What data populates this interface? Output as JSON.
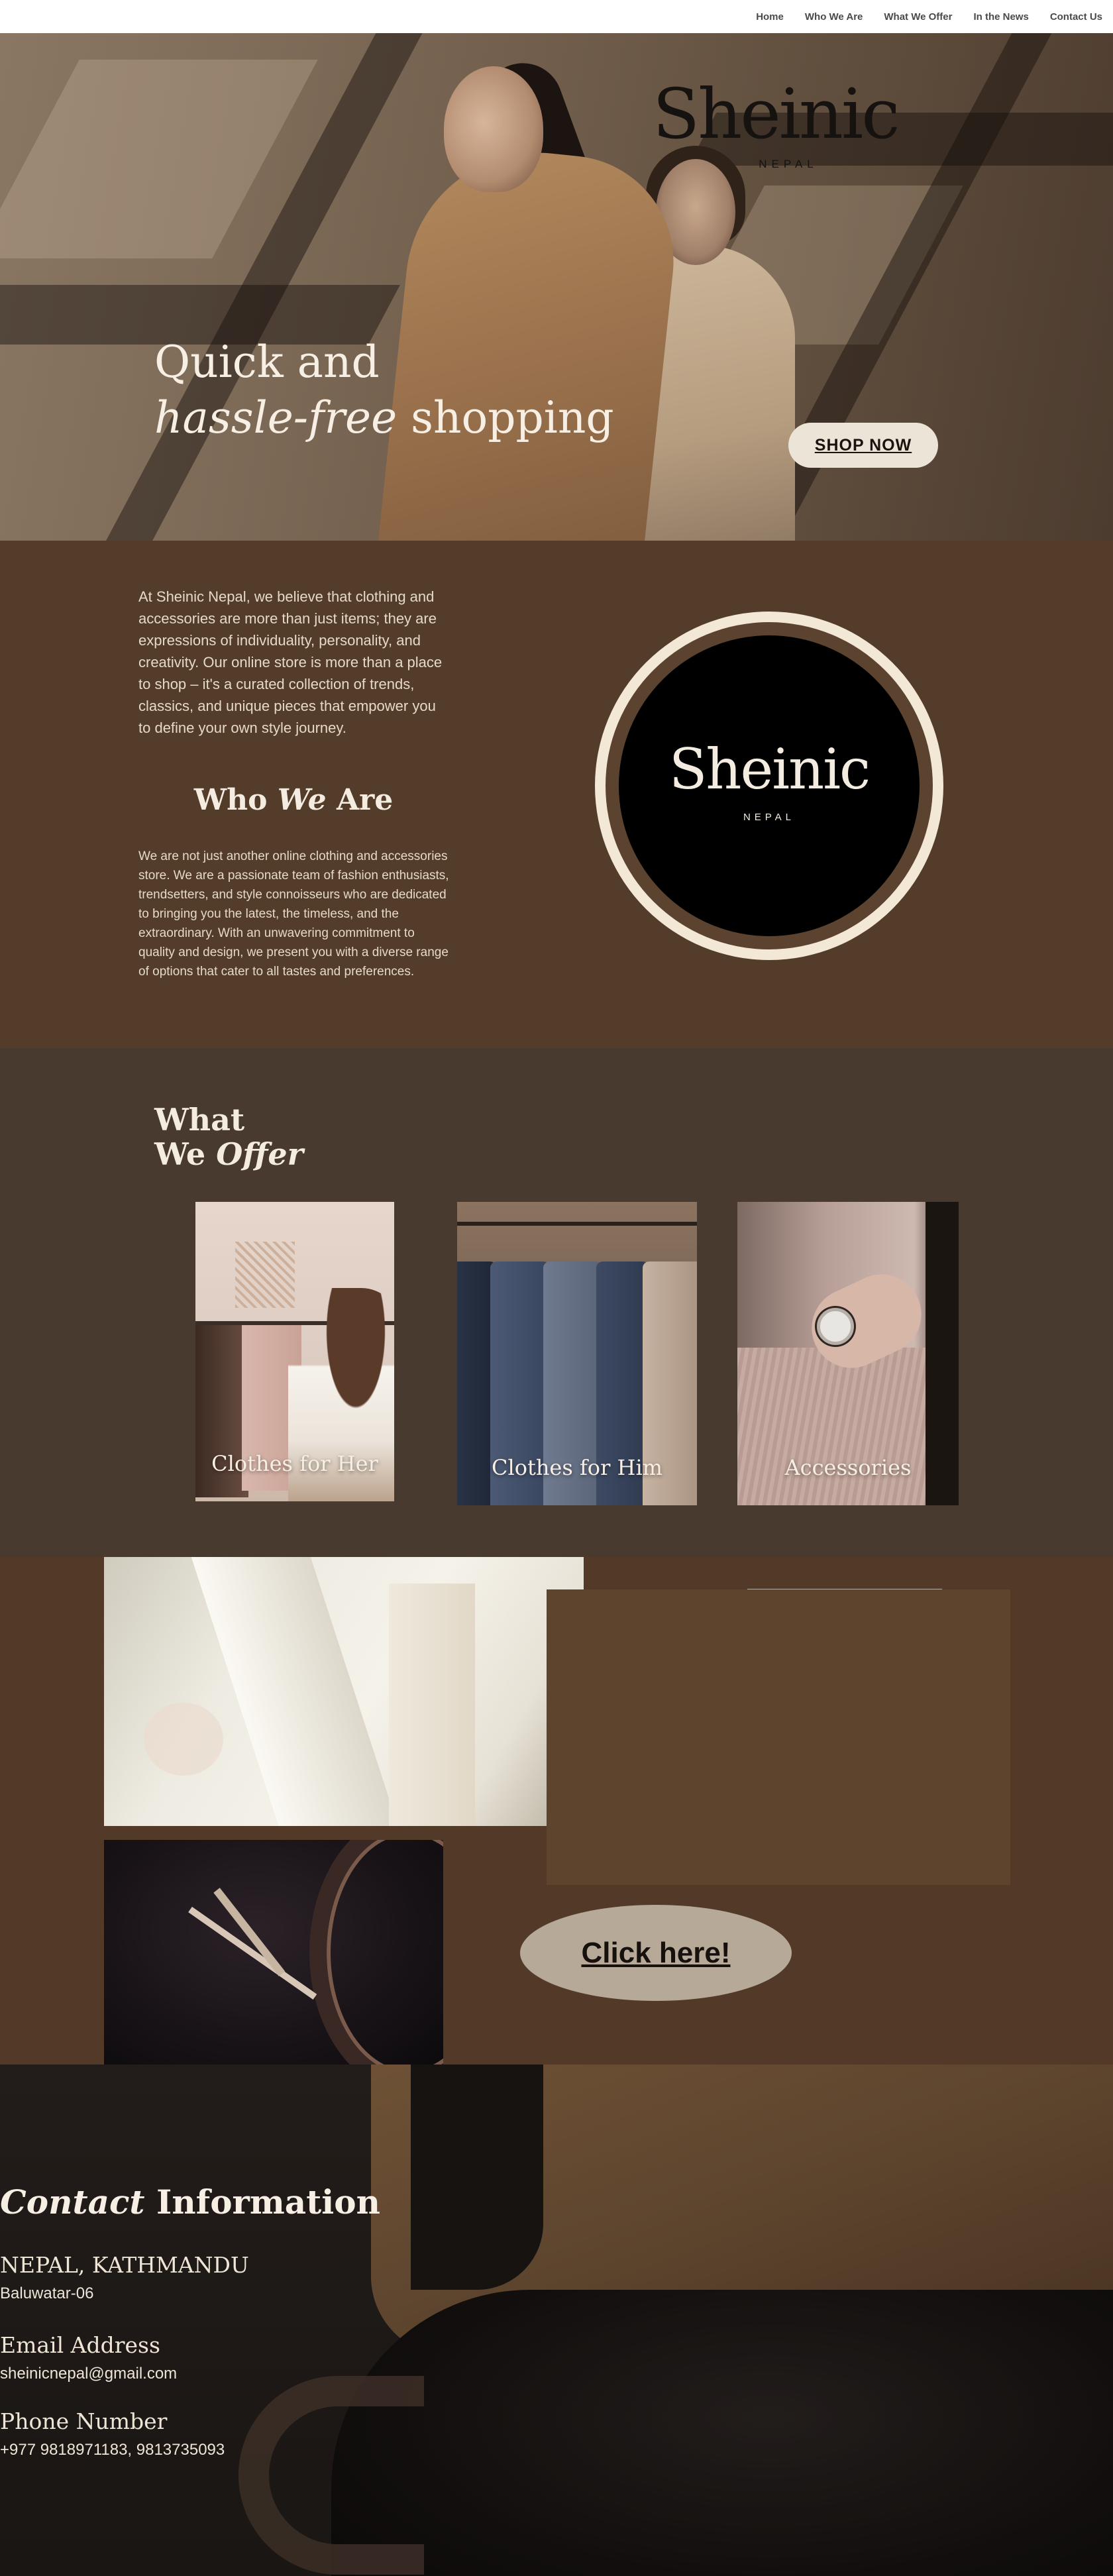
{
  "nav": {
    "links": [
      "Home",
      "Who We Are",
      "What We Offer",
      "In the News",
      "Contact Us"
    ]
  },
  "hero": {
    "logo_name": "Sheinic",
    "logo_sub": "NEPAL",
    "title_line1": "Quick and",
    "title_line2_italic": "hassle-free",
    "title_line2_rest": " shopping",
    "shop_button": "SHOP NOW"
  },
  "about": {
    "intro": "At Sheinic Nepal, we believe that clothing and accessories are more than just items; they are expressions of individuality, personality, and creativity. Our online store is more than a place to shop – it's a curated collection of trends, classics, and unique pieces that empower you to define your own style journey.",
    "heading_pre": "Who ",
    "heading_italic": "We",
    "heading_post": " Are",
    "body": "We are not just another online clothing and accessories store. We are a passionate team of fashion enthusiasts, trendsetters, and style connoisseurs who are dedicated to bringing you the latest, the timeless, and the extraordinary. With an unwavering commitment to quality and design, we present you with a diverse range of options that cater to all tastes and preferences.",
    "logo_name": "Sheinic",
    "logo_sub": "NEPAL"
  },
  "offer": {
    "heading_line1": "What",
    "heading_line2_pre": "We ",
    "heading_line2_italic": "Offer",
    "cards": [
      {
        "label": "Clothes for Her"
      },
      {
        "label": "Clothes for Him"
      },
      {
        "label": "Accessories"
      }
    ]
  },
  "gallery": {
    "button": "Click here!"
  },
  "contact": {
    "title_italic": "Contact",
    "title_rest": " Information",
    "location_label": "NEPAL, KATHMANDU",
    "location_value": "Baluwatar-06",
    "email_label": "Email Address",
    "email_value": "sheinicnepal@gmail.com",
    "phone_label": "Phone Number",
    "phone_value": "+977 9818971183, 9813735093"
  }
}
